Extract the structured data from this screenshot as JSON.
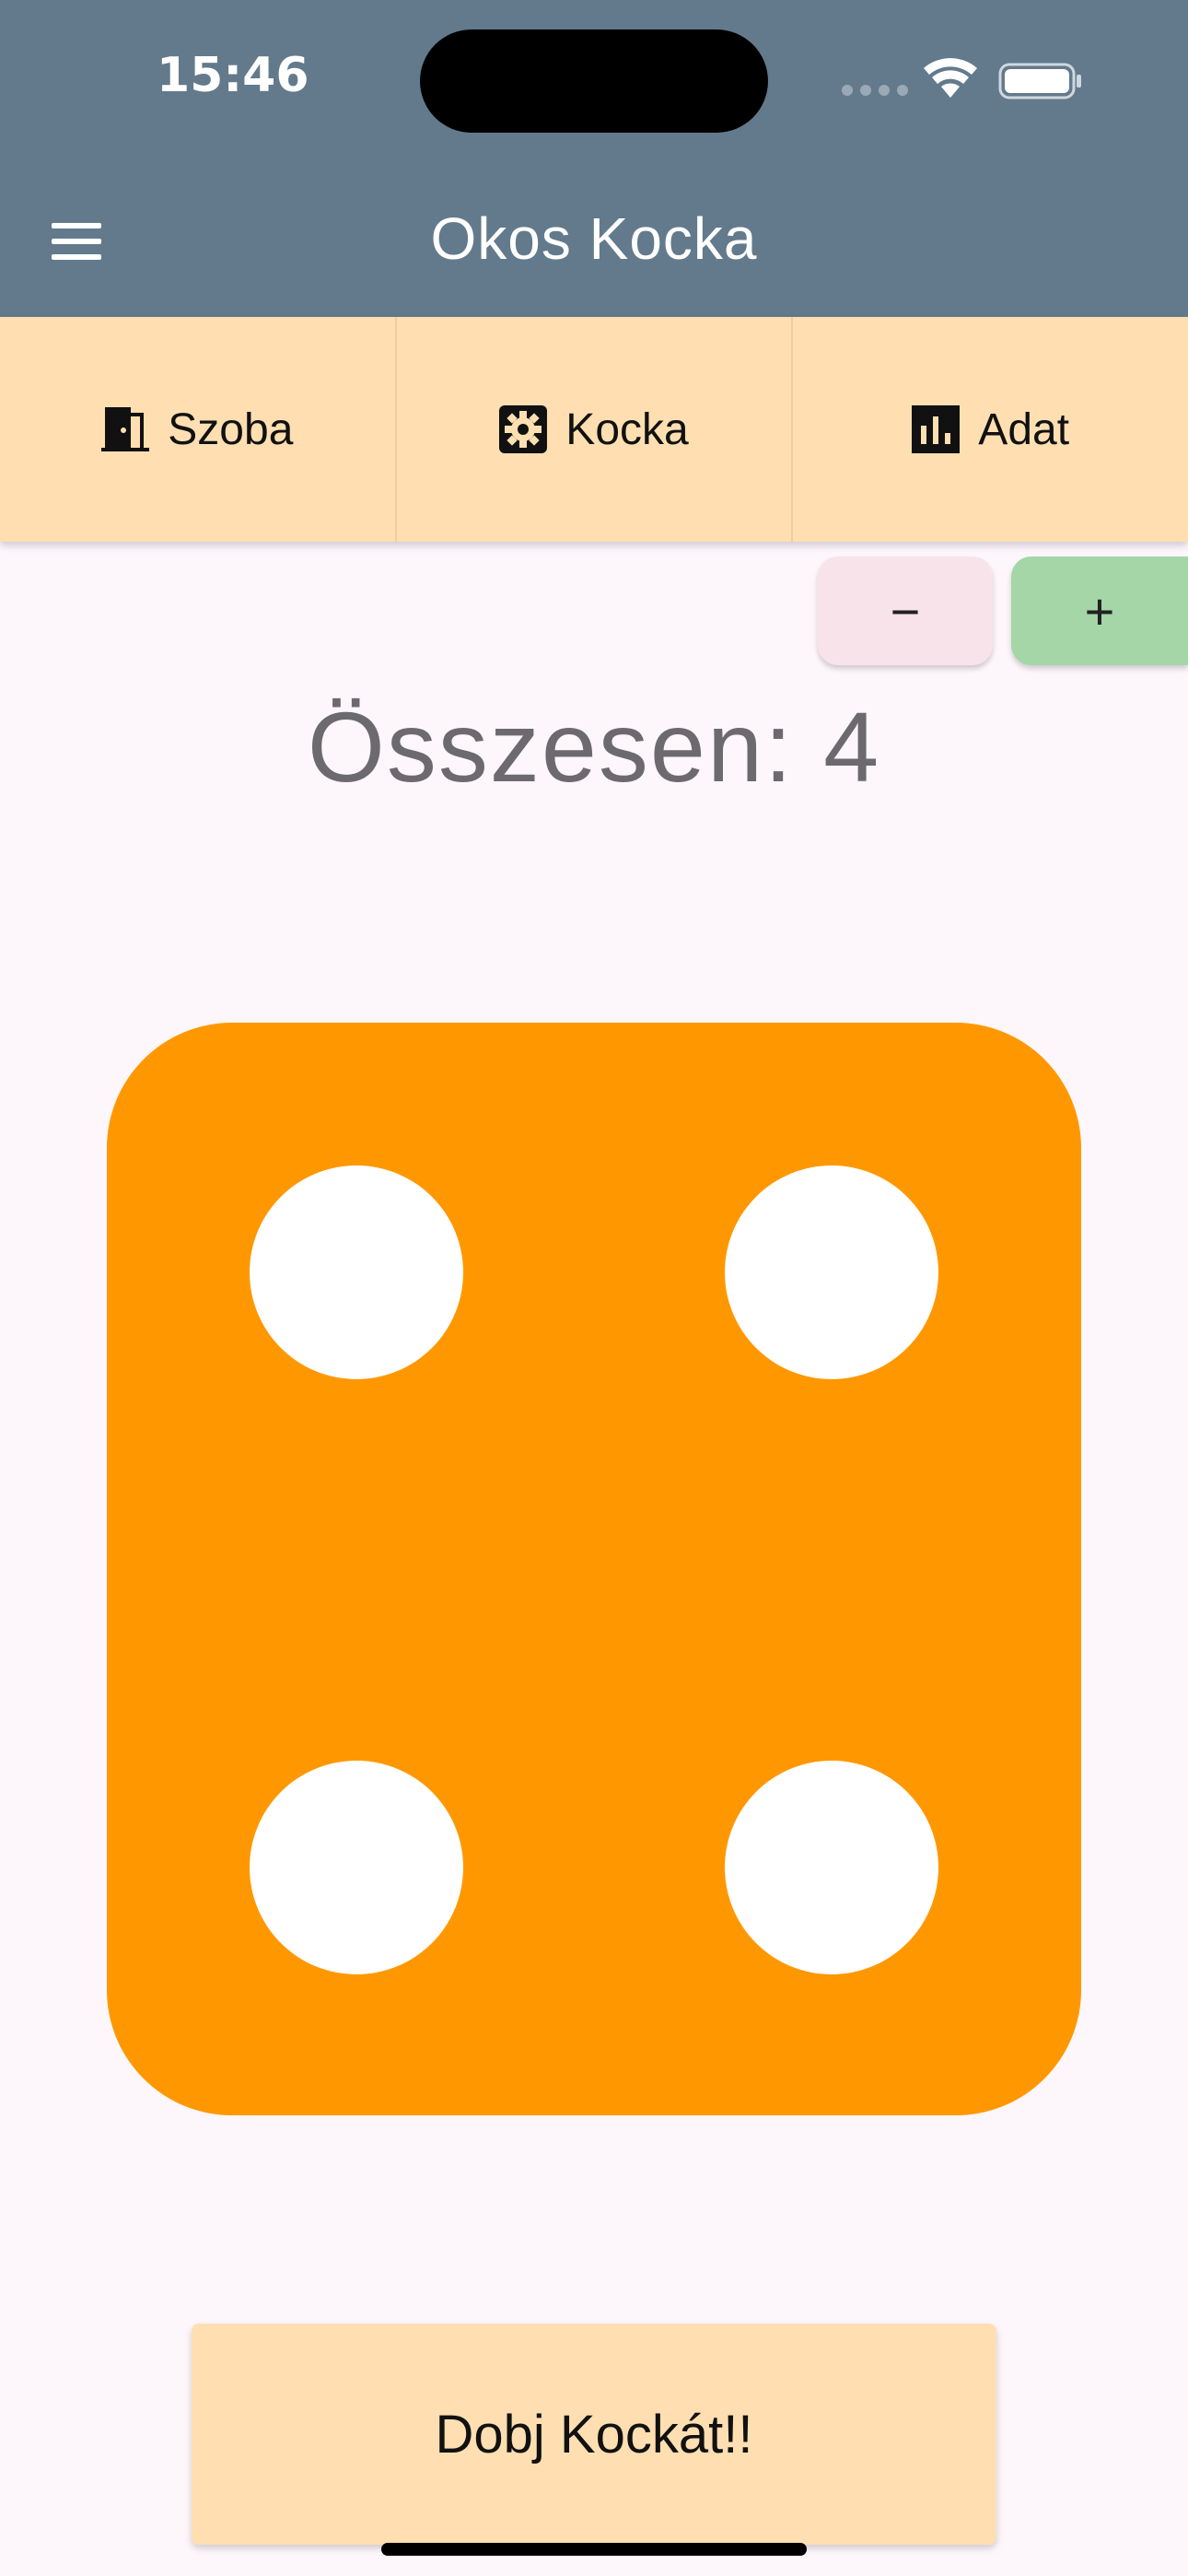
{
  "status_bar": {
    "time": "15:46"
  },
  "app_bar": {
    "title": "Okos Kocka",
    "menu_icon": "hamburger-menu-icon"
  },
  "tabs": [
    {
      "label": "Szoba",
      "icon": "door-icon"
    },
    {
      "label": "Kocka",
      "icon": "gear-icon"
    },
    {
      "label": "Adat",
      "icon": "bar-chart-icon"
    }
  ],
  "controls": {
    "minus_label": "−",
    "plus_label": "+"
  },
  "total": {
    "text": "Összesen: 4"
  },
  "die": {
    "value": 4,
    "color": "#ff9800",
    "pip_color": "#ffffff"
  },
  "roll_button": {
    "label": "Dobj Kockát!!"
  },
  "colors": {
    "app_bar": "#627a8c",
    "tab_bar": "#ffdfb1",
    "minus_button": "#f9e3ea",
    "plus_button": "#a5d6a7",
    "background": "#fdf7fc"
  }
}
